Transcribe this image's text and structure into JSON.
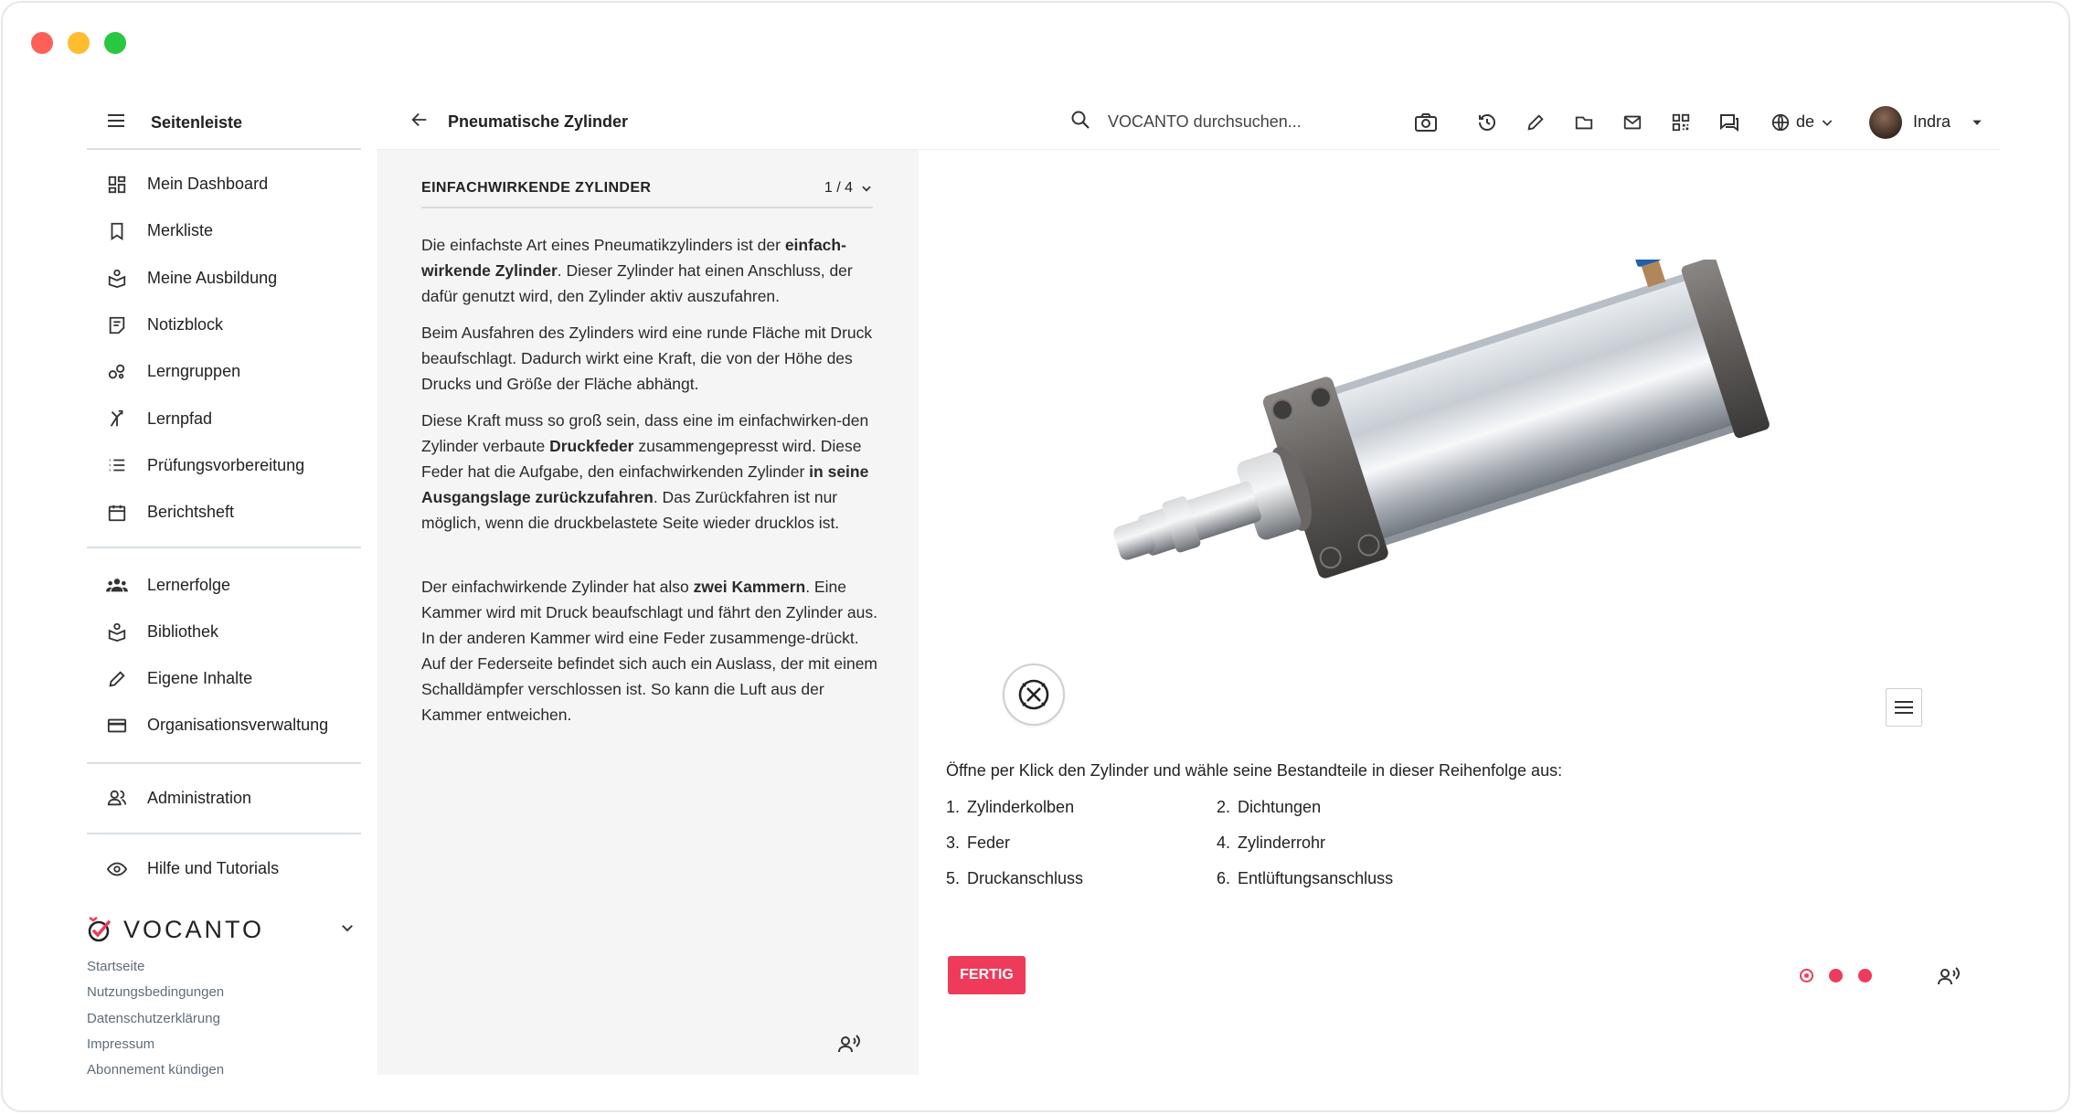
{
  "window": {
    "controls": [
      "close",
      "minimize",
      "maximize"
    ]
  },
  "sidebar": {
    "header": "Seitenleiste",
    "groups": [
      [
        {
          "label": "Mein Dashboard",
          "icon": "dashboard-icon"
        },
        {
          "label": "Merkliste",
          "icon": "bookmark-icon"
        },
        {
          "label": "Meine Ausbildung",
          "icon": "education-icon"
        },
        {
          "label": "Notizblock",
          "icon": "notepad-icon"
        },
        {
          "label": "Lerngruppen",
          "icon": "groups-icon"
        },
        {
          "label": "Lernpfad",
          "icon": "path-icon"
        },
        {
          "label": "Prüfungsvorbereitung",
          "icon": "list-icon"
        },
        {
          "label": "Berichtsheft",
          "icon": "calendar-icon"
        }
      ],
      [
        {
          "label": "Lernerfolge",
          "icon": "people-icon"
        },
        {
          "label": "Bibliothek",
          "icon": "library-icon"
        },
        {
          "label": "Eigene Inhalte",
          "icon": "pencil-icon"
        },
        {
          "label": "Organisationsverwaltung",
          "icon": "card-icon"
        }
      ],
      [
        {
          "label": "Administration",
          "icon": "admin-icon"
        }
      ],
      [
        {
          "label": "Hilfe und Tutorials",
          "icon": "eye-icon"
        }
      ]
    ],
    "brand": "VOCANTO",
    "footer_links": [
      "Startseite",
      "Nutzungsbedingungen",
      "Datenschutzerklärung",
      "Impressum",
      "Abonnement kündigen"
    ]
  },
  "header": {
    "title": "Pneumatische Zylinder",
    "search_placeholder": "VOCANTO durchsuchen...",
    "tools": [
      "camera-icon",
      "history-icon",
      "edit-icon",
      "folder-icon",
      "mail-icon",
      "qr-icon",
      "chat-icon"
    ],
    "language": "de",
    "user": "Indra"
  },
  "chapter": {
    "name": "EINFACHWIRKENDE ZYLINDER",
    "page": "1 / 4"
  },
  "text": {
    "p1": [
      {
        "t": "Die einfachste Art eines Pneumatikzylinders ist der "
      },
      {
        "t": "einfach-wirkende Zylinder",
        "b": true
      },
      {
        "t": ". Dieser Zylinder hat einen Anschluss, der dafür genutzt wird, den Zylinder aktiv auszufahren."
      }
    ],
    "p2": [
      {
        "t": "Beim Ausfahren des Zylinders wird eine runde Fläche mit Druck beaufschlagt. Dadurch wirkt eine Kraft, die von der Höhe des Drucks und Größe der Fläche abhängt."
      }
    ],
    "p3": [
      {
        "t": "Diese Kraft muss so groß sein, dass eine im einfachwirken-den Zylinder verbaute "
      },
      {
        "t": "Druckfeder",
        "b": true
      },
      {
        "t": " zusammengepresst wird. Diese Feder hat die Aufgabe, den einfachwirkenden Zylinder "
      },
      {
        "t": "in seine Ausgangslage zurückzufahren",
        "b": true
      },
      {
        "t": ". Das Zurückfahren ist nur möglich, wenn die druckbelastete Seite wieder drucklos ist."
      }
    ],
    "p4": [
      {
        "t": "Der einfachwirkende Zylinder hat also "
      },
      {
        "t": "zwei Kammern",
        "b": true
      },
      {
        "t": ". Eine Kammer wird mit Druck beaufschlagt und fährt den Zylinder aus. In der anderen Kammer wird eine Feder zusammenge-drückt. Auf der Federseite befindet sich auch ein Auslass, der mit einem Schalldämpfer verschlossen ist. So kann die Luft aus der Kammer entweichen."
      }
    ]
  },
  "task": {
    "instruction": "Öffne per Klick den Zylinder und wähle seine Bestandteile in dieser Reihenfolge aus:",
    "steps": [
      {
        "n": "1.",
        "label": "Zylinderkolben"
      },
      {
        "n": "2.",
        "label": "Dichtungen"
      },
      {
        "n": "3.",
        "label": "Feder"
      },
      {
        "n": "4.",
        "label": "Zylinderrohr"
      },
      {
        "n": "5.",
        "label": "Druckanschluss"
      },
      {
        "n": "6.",
        "label": "Entlüftungsanschluss"
      }
    ],
    "done_label": "FERTIG"
  },
  "pager": {
    "count": 3,
    "active": 1
  },
  "colors": {
    "accent": "#ee3b5b",
    "divider": "#d8dfe6",
    "panel_bg": "#f5f5f5"
  }
}
